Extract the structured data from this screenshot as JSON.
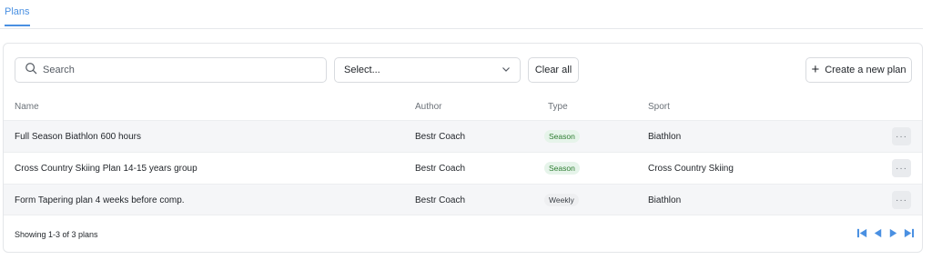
{
  "tabs": [
    {
      "label": "Plans",
      "active": true
    }
  ],
  "toolbar": {
    "search_placeholder": "Search",
    "select_value": "Select...",
    "clear_label": "Clear all",
    "create_label": "Create a new plan"
  },
  "table": {
    "columns": [
      "Name",
      "Author",
      "Type",
      "Sport"
    ],
    "rows": [
      {
        "name": "Full Season Biathlon 600 hours",
        "author": "Bestr Coach",
        "type": "Season",
        "sport": "Biathlon"
      },
      {
        "name": "Cross Country Skiing Plan 14-15 years group",
        "author": "Bestr Coach",
        "type": "Season",
        "sport": "Cross Country Skiing"
      },
      {
        "name": "Form Tapering plan 4 weeks before comp.",
        "author": "Bestr Coach",
        "type": "Weekly",
        "sport": "Biathlon"
      }
    ],
    "more_label": "···"
  },
  "footer": {
    "count_text": "Showing 1-3 of 3 plans"
  },
  "icons": {
    "search": "search-icon",
    "chevron": "chevron-down-icon",
    "plus": "plus-icon",
    "first": "first-page-icon",
    "prev": "prev-page-icon",
    "next": "next-page-icon",
    "last": "last-page-icon"
  },
  "colors": {
    "accent": "#4a90e2",
    "season_bg": "#e6f4ea",
    "season_fg": "#2e7d32",
    "weekly_bg": "#eeeff1"
  }
}
